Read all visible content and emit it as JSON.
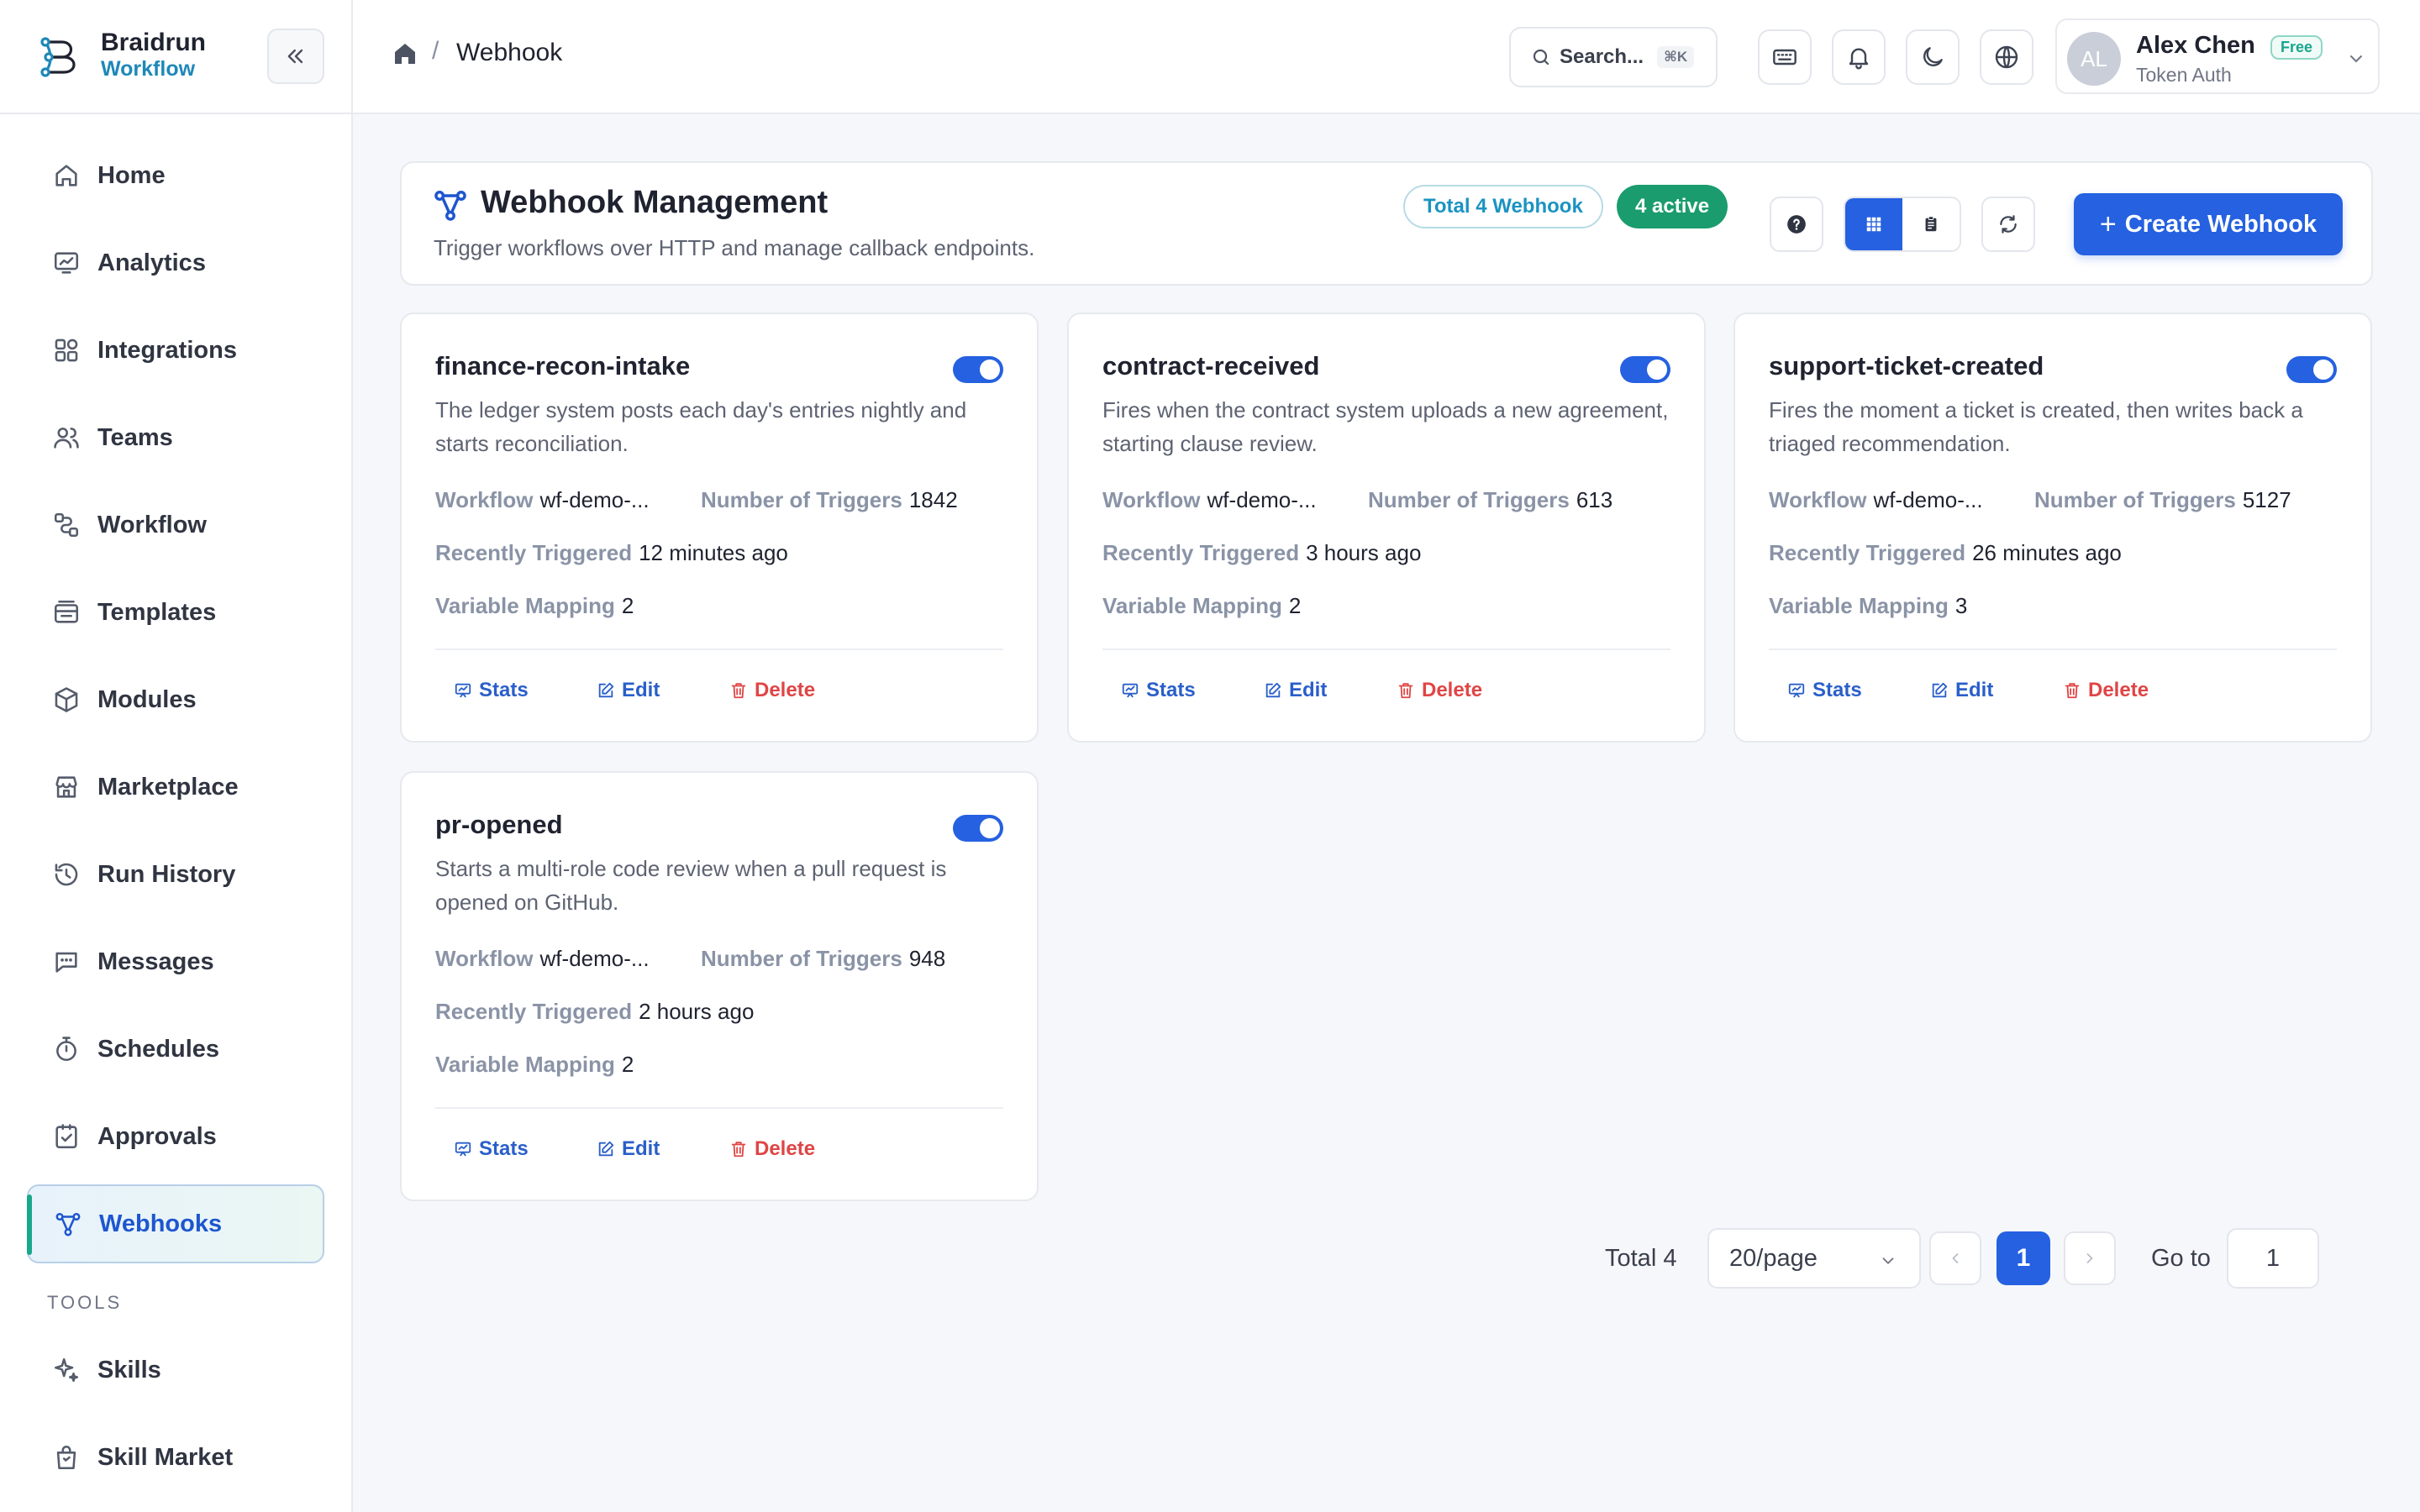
{
  "brand": {
    "name": "Braidrun",
    "sub": "Workflow"
  },
  "sidebar": {
    "items": [
      {
        "label": "Home",
        "icon": "home-icon"
      },
      {
        "label": "Analytics",
        "icon": "analytics-icon"
      },
      {
        "label": "Integrations",
        "icon": "integrations-icon"
      },
      {
        "label": "Teams",
        "icon": "teams-icon"
      },
      {
        "label": "Workflow",
        "icon": "workflow-icon"
      },
      {
        "label": "Templates",
        "icon": "templates-icon"
      },
      {
        "label": "Modules",
        "icon": "modules-icon"
      },
      {
        "label": "Marketplace",
        "icon": "marketplace-icon"
      },
      {
        "label": "Run History",
        "icon": "history-icon"
      },
      {
        "label": "Messages",
        "icon": "messages-icon"
      },
      {
        "label": "Schedules",
        "icon": "timer-icon"
      },
      {
        "label": "Approvals",
        "icon": "approvals-icon"
      },
      {
        "label": "Webhooks",
        "icon": "webhook-icon",
        "active": true
      }
    ],
    "tools_label": "TOOLS",
    "tools": [
      {
        "label": "Skills",
        "icon": "sparkle-icon"
      },
      {
        "label": "Skill Market",
        "icon": "bag-icon"
      }
    ]
  },
  "header": {
    "breadcrumb_current": "Webhook",
    "breadcrumb_sep": "/",
    "search_placeholder": "Search...",
    "search_shortcut": "⌘K"
  },
  "user": {
    "name": "Alex Chen",
    "initials": "AL",
    "badge": "Free",
    "auth": "Token Auth"
  },
  "page": {
    "title": "Webhook Management",
    "description": "Trigger workflows over HTTP and manage callback endpoints.",
    "total_chip": "Total 4 Webhook",
    "active_chip": "4 active",
    "create_label": "Create Webhook"
  },
  "labels": {
    "workflow": "Workflow",
    "triggers": "Number of Triggers",
    "recent": "Recently Triggered",
    "mapping": "Variable Mapping",
    "stats": "Stats",
    "edit": "Edit",
    "delete": "Delete"
  },
  "webhooks": [
    {
      "name": "finance-recon-intake",
      "description": "The ledger system posts each day's entries nightly and starts reconciliation.",
      "workflow": "wf-demo-...",
      "triggers": "1842",
      "recent": "12 minutes ago",
      "mapping": "2",
      "enabled": true
    },
    {
      "name": "contract-received",
      "description": "Fires when the contract system uploads a new agreement, starting clause review.",
      "workflow": "wf-demo-...",
      "triggers": "613",
      "recent": "3 hours ago",
      "mapping": "2",
      "enabled": true
    },
    {
      "name": "support-ticket-created",
      "description": "Fires the moment a ticket is created, then writes back a triaged recommendation.",
      "workflow": "wf-demo-...",
      "triggers": "5127",
      "recent": "26 minutes ago",
      "mapping": "3",
      "enabled": true
    },
    {
      "name": "pr-opened",
      "description": "Starts a multi-role code review when a pull request is opened on GitHub.",
      "workflow": "wf-demo-...",
      "triggers": "948",
      "recent": "2 hours ago",
      "mapping": "2",
      "enabled": true
    }
  ],
  "pagination": {
    "total": "Total 4",
    "page_size": "20/page",
    "current": "1",
    "goto_label": "Go to",
    "goto_value": "1"
  },
  "colors": {
    "accent": "#2561e0",
    "active_green": "#1a9c6e",
    "delete_red": "#e04545",
    "brand_teal": "#1e88b8"
  }
}
